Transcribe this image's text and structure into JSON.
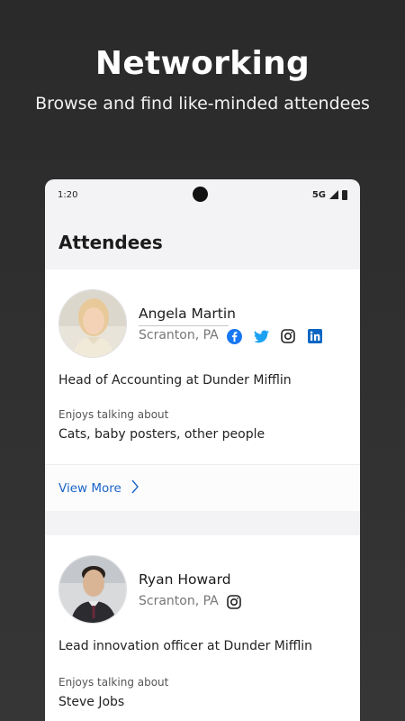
{
  "promo": {
    "title": "Networking",
    "subtitle": "Browse and find like-minded attendees"
  },
  "status_bar": {
    "time": "1:20",
    "network": "5G"
  },
  "screen": {
    "title": "Attendees"
  },
  "attendees": [
    {
      "name": "Angela Martin",
      "location": "Scranton, PA",
      "socials": [
        "facebook-icon",
        "twitter-icon",
        "instagram-icon",
        "linkedin-icon"
      ],
      "job": "Head of Accounting at Dunder Mifflin",
      "enjoys_label": "Enjoys talking about",
      "enjoys": "Cats, baby posters, other people",
      "view_more": "View More"
    },
    {
      "name": "Ryan Howard",
      "location": "Scranton, PA",
      "socials": [
        "instagram-icon"
      ],
      "job": "Lead innovation officer at Dunder Mifflin",
      "enjoys_label": "Enjoys talking about",
      "enjoys": "Steve Jobs"
    }
  ],
  "colors": {
    "link": "#1b65c8",
    "facebook": "#1877f2",
    "twitter": "#1da1f2",
    "linkedin": "#0a66c2"
  }
}
